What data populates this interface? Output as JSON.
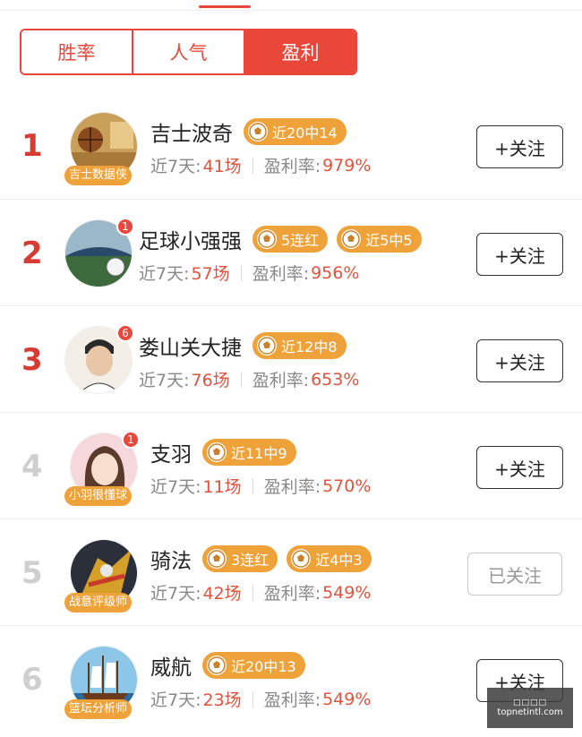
{
  "tabs": [
    {
      "label": "胜率",
      "active": false
    },
    {
      "label": "人气",
      "active": false
    },
    {
      "label": "盈利",
      "active": true
    }
  ],
  "stats_labels": {
    "recent": "近7天:",
    "profit_rate": "盈利率:"
  },
  "rows": [
    {
      "rank": "1",
      "name": "吉士波奇",
      "tag": "吉士数据侠",
      "notification": "",
      "badges": [
        "近20中14"
      ],
      "recent": "41场",
      "profit": "979%",
      "follow": "+关注",
      "followed": false
    },
    {
      "rank": "2",
      "name": "足球小强强",
      "tag": "",
      "notification": "1",
      "badges": [
        "5连红",
        "近5中5"
      ],
      "recent": "57场",
      "profit": "956%",
      "follow": "+关注",
      "followed": false
    },
    {
      "rank": "3",
      "name": "娄山关大捷",
      "tag": "",
      "notification": "6",
      "badges": [
        "近12中8"
      ],
      "recent": "76场",
      "profit": "653%",
      "follow": "+关注",
      "followed": false
    },
    {
      "rank": "4",
      "name": "支羽",
      "tag": "小羽很懂球",
      "notification": "1",
      "badges": [
        "近11中9"
      ],
      "recent": "11场",
      "profit": "570%",
      "follow": "+关注",
      "followed": false
    },
    {
      "rank": "5",
      "name": "骑法",
      "tag": "战意评级师",
      "notification": "",
      "badges": [
        "3连红",
        "近4中3"
      ],
      "recent": "42场",
      "profit": "549%",
      "follow": "已关注",
      "followed": true
    },
    {
      "rank": "6",
      "name": "威航",
      "tag": "篮坛分析师",
      "notification": "",
      "badges": [
        "近20中13"
      ],
      "recent": "23场",
      "profit": "549%",
      "follow": "+关注",
      "followed": false
    }
  ],
  "watermark": {
    "top": "□□□□",
    "bottom": "topnetintl.com"
  },
  "colors": {
    "accent": "#e8473a",
    "badge": "#f0a23a",
    "value": "#e0533e"
  }
}
